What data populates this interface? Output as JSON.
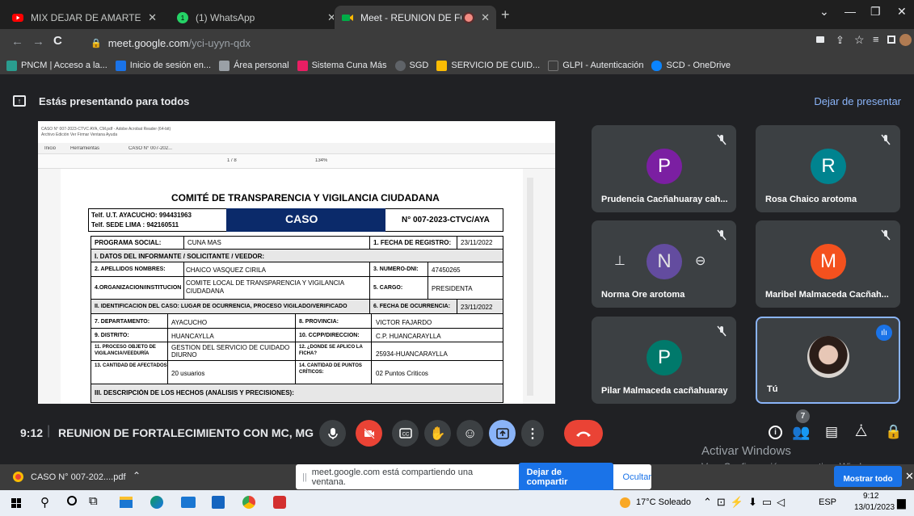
{
  "browser": {
    "tabs": [
      {
        "title": "MIX DEJAR DE AMARTE - REBELD",
        "icon": "youtube-icon"
      },
      {
        "title": "(1) WhatsApp",
        "icon": "whatsapp-icon"
      },
      {
        "title": "Meet - REUNION DE FORTAL",
        "icon": "meet-icon"
      }
    ],
    "url_host": "meet.google.com",
    "url_path": "/yci-uyyn-qdx",
    "bookmarks": [
      "PNCM | Acceso a la...",
      "Inicio de sesión en...",
      "Área personal",
      "Sistema Cuna Más",
      "SGD",
      "SERVICIO DE CUID...",
      "GLPI - Autenticación",
      "SCD - OneDrive"
    ]
  },
  "meet": {
    "presenting_text": "Estás presentando para todos",
    "stop_presenting": "Dejar de presentar",
    "time": "9:12",
    "meeting_title": "REUNION DE FORTALECIMIENTO CON MC, MG",
    "people_count": "7",
    "participants": [
      {
        "name": "Prudencia Cacñahuaray cah...",
        "initial": "P",
        "color": "#7b1fa2"
      },
      {
        "name": "Rosa Chaico arotoma",
        "initial": "R",
        "color": "#00838f"
      },
      {
        "name": "Norma Ore arotoma",
        "initial": "N",
        "color": "#6a4fb0"
      },
      {
        "name": "Maribel Malmaceda Cacñah...",
        "initial": "M",
        "color": "#f4511e"
      },
      {
        "name": "Pilar Malmaceda cacñahuaray",
        "initial": "P",
        "color": "#00796b"
      },
      {
        "name": "Tú",
        "initial": "",
        "color": "#5f6368"
      }
    ],
    "activate_title": "Activar Windows",
    "activate_sub": "Ve a Configuración para activar Windows.",
    "show_all": "Mostrar todo"
  },
  "pdf": {
    "window_title": "CASO N° 007-2023-CTVC AYA, CM.pdf - Adobe Acrobat Reader (64-bit)",
    "menu": "Archivo  Edición  Ver  Firmar  Ventana  Ayuda",
    "nav_tabs": [
      "Inicio",
      "Herramientas",
      "CASO N° 007-202..."
    ],
    "toolbar_page": "1 / 8",
    "toolbar_zoom": "134%",
    "title": "COMITÉ DE TRANSPARENCIA Y VIGILANCIA CIUDADANA",
    "phone1": "Telf. U.T. AYACUCHO: 994431963",
    "phone2": "Telf. SEDE LIMA : 942160511",
    "caso": "CASO",
    "caso_no": "N° 007-2023-CTVC/AYA",
    "rows": {
      "prog_label": "PROGRAMA SOCIAL:",
      "prog_value": "CUNA MAS",
      "fecha_reg_label": "1. FECHA DE REGISTRO:",
      "fecha_reg_value": "23/11/2022",
      "sec1": "I. DATOS DEL INFORMANTE / SOLICITANTE / VEEDOR:",
      "apellidos_label": "2. APELLIDOS NOMBRES:",
      "apellidos_value": "CHAICO VASQUEZ CIRILA",
      "dni_label": "3. NÚMERO-DNI:",
      "dni_value": "47450265",
      "org_label": "4.ORGANIZACIÓN/INSTITUCIÓN",
      "org_value": "COMITE LOCAL DE TRANSPARENCIA Y VIGILANCIA CIUDADANA",
      "cargo_label": "5. CARGO:",
      "cargo_value": "PRESIDENTA",
      "sec2": "II. IDENTIFICACIÓN DEL CASO: LUGAR DE OCURRENCIA, PROCESO VIGILADO/VERIFICADO",
      "fecha_oc_label": "6. FECHA DE OCURRENCIA:",
      "fecha_oc_value": "23/11/2022",
      "dep_label": "7. DEPARTAMENTO:",
      "dep_value": "AYACUCHO",
      "prov_label": "8. PROVINCIA:",
      "prov_value": "VICTOR FAJARDO",
      "dist_label": "9. DISTRITO:",
      "dist_value": "HUANCAYLLA",
      "ccpp_label": "10. CCPP/DIRECCIÓN:",
      "ccpp_value": "C.P. HUANCARAYLLA",
      "proc_label": "11. PROCESO OBJETO DE VIGILANCIA/VEEDURÍA",
      "proc_value": "GESTION DEL SERVICIO DE CUIDADO DIURNO",
      "ficha_label": "12. ¿DÓNDE SE APLICÓ LA FICHA?",
      "ficha_value": "25934-HUANCARAYLLA",
      "afect_label": "13. CANTIDAD DE AFECTADOS:",
      "afect_value": "20 usuarios",
      "crit_label": "14. CANTIDAD DE PUNTOS CRÍTICOS:",
      "crit_value": "02 Puntos Criticos",
      "sec3": "III. DESCRIPCIÓN DE LOS HECHOS (ANÁLISIS Y PRECISIONES):"
    }
  },
  "downloads": {
    "file": "CASO N° 007-202....pdf",
    "share_msg": "meet.google.com está compartiendo una ventana.",
    "stop_share": "Dejar de compartir",
    "hide": "Ocultar"
  },
  "taskbar": {
    "weather": "17°C Soleado",
    "lang": "ESP",
    "time": "9:12",
    "date": "13/01/2023"
  }
}
